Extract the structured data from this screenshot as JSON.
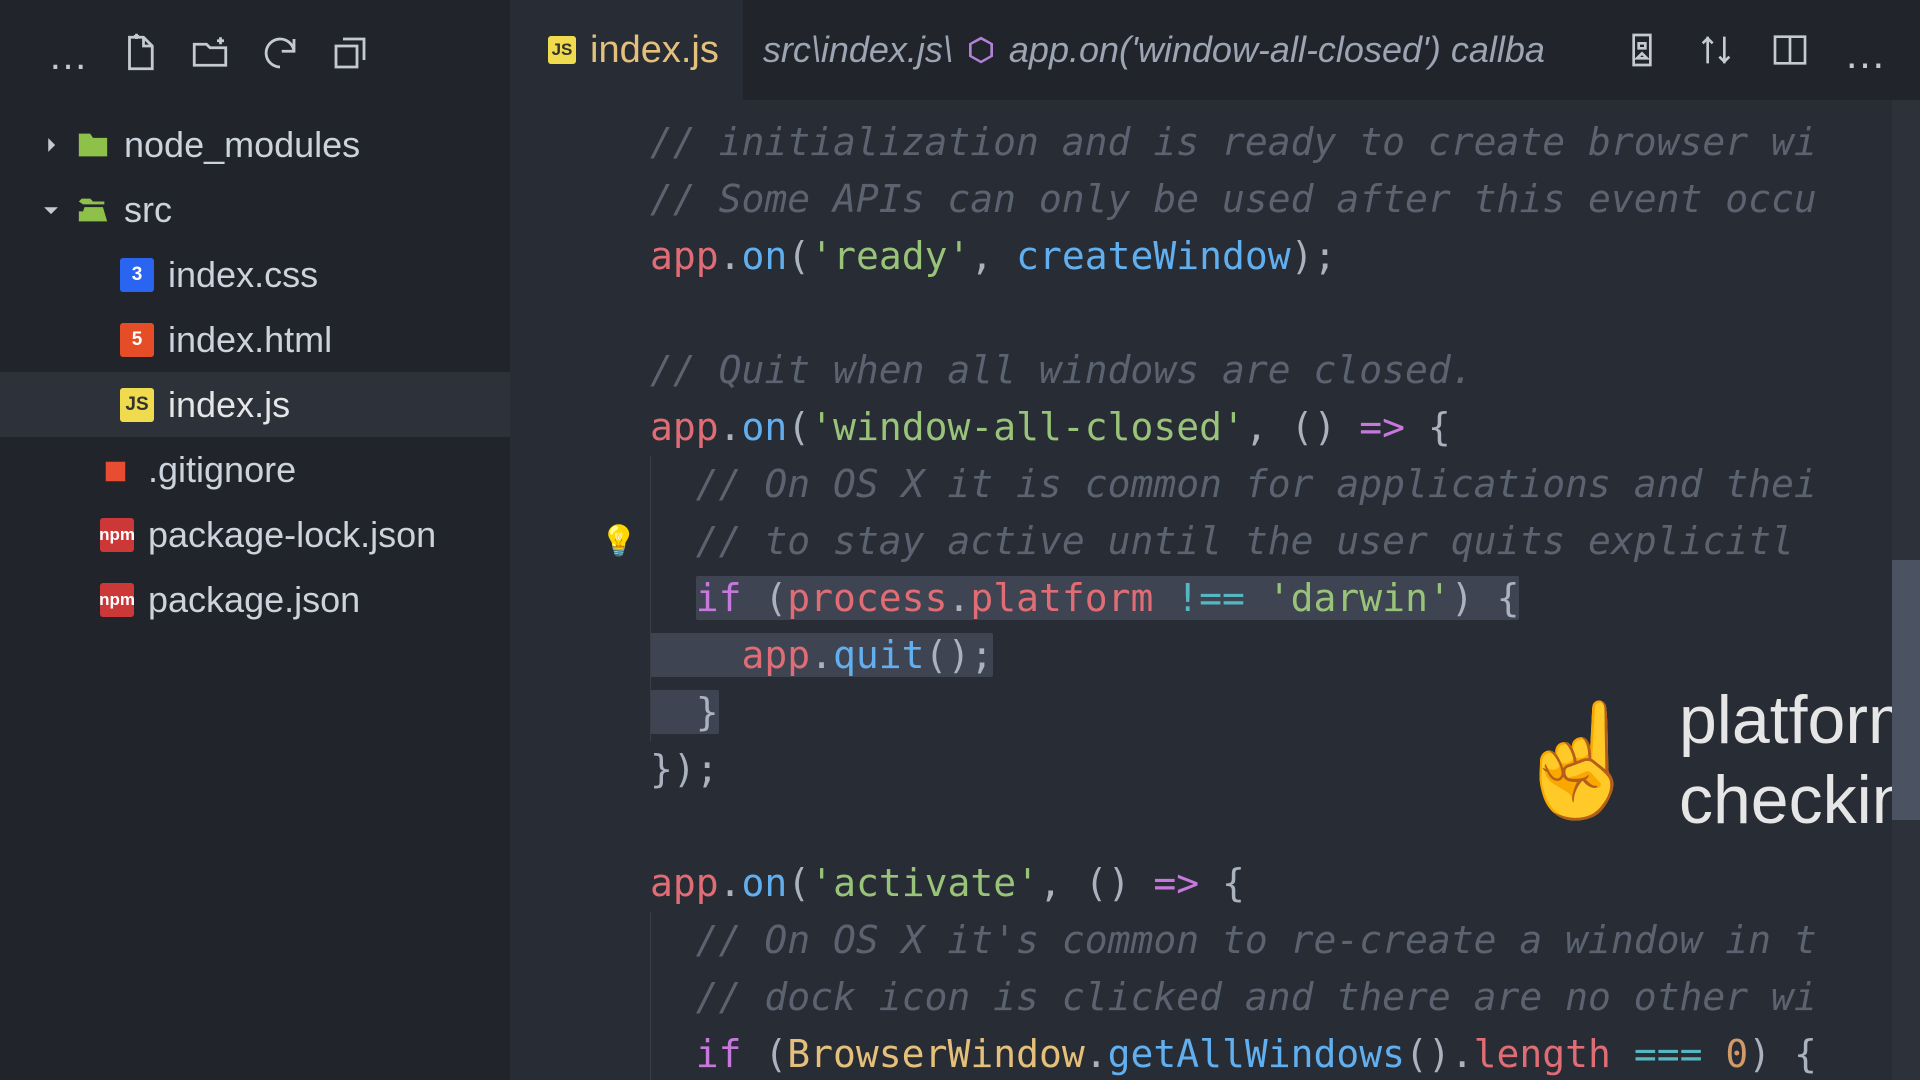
{
  "sidebar": {
    "tree": {
      "node_modules": "node_modules",
      "src": "src",
      "files": {
        "css": "index.css",
        "html": "index.html",
        "js": "index.js"
      },
      "gitignore": ".gitignore",
      "pkglock": "package-lock.json",
      "pkg": "package.json"
    }
  },
  "tab": {
    "title": "index.js",
    "breadcrumb_path": "src\\index.js\\",
    "breadcrumb_symbol": "app.on('window-all-closed') callba"
  },
  "annotation": {
    "emoji": "☝️",
    "line1": "platform",
    "line2": "checking"
  },
  "code": {
    "l1_comment": "// initialization and is ready to create browser wi",
    "l2_comment": "// Some APIs can only be used after this event occu",
    "l3_app": "app",
    "l3_on": "on",
    "l3_ready": "'ready'",
    "l3_cw": "createWindow",
    "l5_comment": "// Quit when all windows are closed.",
    "l6_app": "app",
    "l6_on": "on",
    "l6_evt": "'window-all-closed'",
    "l7_comment": "// On OS X it is common for applications and thei",
    "l8_comment": "// to stay active until the user quits explicitl",
    "l9_if": "if",
    "l9_process": "process",
    "l9_platform": "platform",
    "l9_neq": "!==",
    "l9_darwin": "'darwin'",
    "l10_app": "app",
    "l10_quit": "quit",
    "l14_app": "app",
    "l14_on": "on",
    "l14_evt": "'activate'",
    "l15_comment": "// On OS X it's common to re-create a window in t",
    "l16_comment": "// dock icon is clicked and there are no other wi",
    "l17_if": "if",
    "l17_bw": "BrowserWindow",
    "l17_gaw": "getAllWindows",
    "l17_len": "length",
    "l17_eq": "===",
    "l17_zero": "0"
  }
}
